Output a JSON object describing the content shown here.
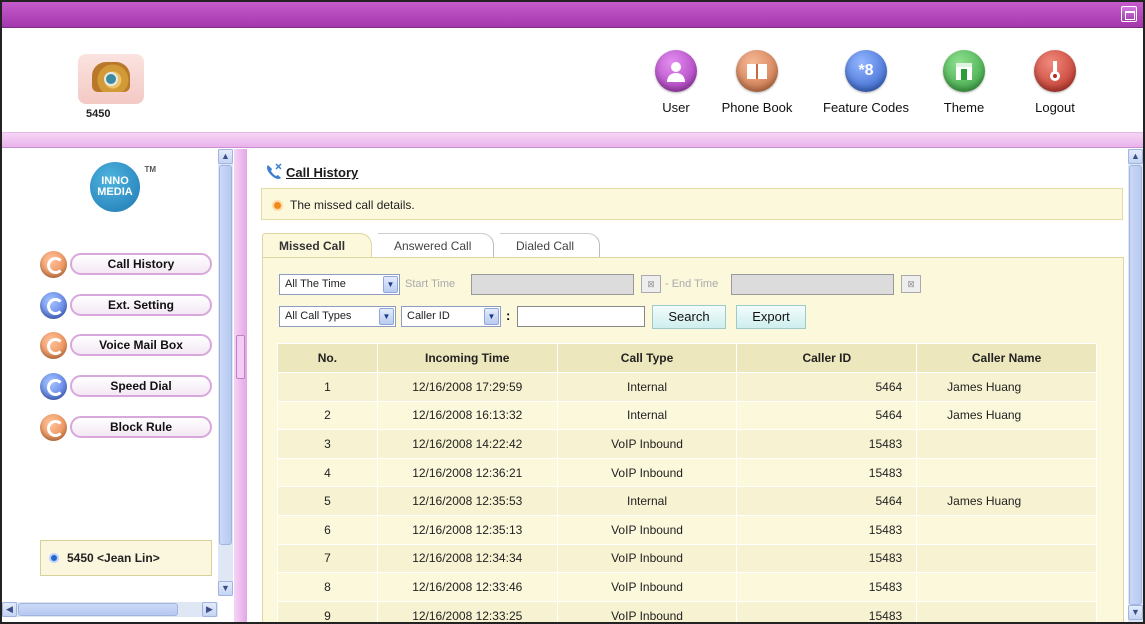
{
  "header": {
    "extension": "5450",
    "nav": [
      {
        "label": "User",
        "icon": "user-icon",
        "color": "#b043c2"
      },
      {
        "label": "Phone Book",
        "icon": "book-icon",
        "color": "#d07a4a"
      },
      {
        "label": "Feature Codes",
        "icon": "star8-icon",
        "glyph": "*8",
        "color": "#3a6fd6"
      },
      {
        "label": "Theme",
        "icon": "theme-icon",
        "color": "#3fb04a"
      },
      {
        "label": "Logout",
        "icon": "key-icon",
        "color": "#c63a2c"
      }
    ]
  },
  "sidebar": {
    "logo": {
      "line1": "INNO",
      "line2": "MEDIA",
      "tm": "TM"
    },
    "items": [
      {
        "label": "Call History",
        "color": "orange"
      },
      {
        "label": "Ext. Setting",
        "color": "blue"
      },
      {
        "label": "Voice Mail Box",
        "color": "orange"
      },
      {
        "label": "Speed Dial",
        "color": "blue"
      },
      {
        "label": "Block Rule",
        "color": "orange"
      }
    ],
    "user": "5450 <Jean Lin>"
  },
  "main": {
    "title": "Call History",
    "info": "The missed call details.",
    "tabs": [
      "Missed Call",
      "Answered Call",
      "Dialed Call"
    ],
    "filters": {
      "time_range": "All The Time",
      "start_label": "Start Time",
      "end_label": "- End Time",
      "call_types": "All Call Types",
      "search_field": "Caller ID",
      "colon": ":",
      "keyword": "",
      "search_button": "Search",
      "export_button": "Export"
    },
    "table": {
      "columns": [
        "No.",
        "Incoming Time",
        "Call Type",
        "Caller ID",
        "Caller Name"
      ],
      "rows": [
        [
          "1",
          "12/16/2008 17:29:59",
          "Internal",
          "5464",
          "James Huang"
        ],
        [
          "2",
          "12/16/2008 16:13:32",
          "Internal",
          "5464",
          "James Huang"
        ],
        [
          "3",
          "12/16/2008 14:22:42",
          "VoIP Inbound",
          "15483",
          ""
        ],
        [
          "4",
          "12/16/2008 12:36:21",
          "VoIP Inbound",
          "15483",
          ""
        ],
        [
          "5",
          "12/16/2008 12:35:53",
          "Internal",
          "5464",
          "James Huang"
        ],
        [
          "6",
          "12/16/2008 12:35:13",
          "VoIP Inbound",
          "15483",
          ""
        ],
        [
          "7",
          "12/16/2008 12:34:34",
          "VoIP Inbound",
          "15483",
          ""
        ],
        [
          "8",
          "12/16/2008 12:33:46",
          "VoIP Inbound",
          "15483",
          ""
        ],
        [
          "9",
          "12/16/2008 12:33:25",
          "VoIP Inbound",
          "15483",
          ""
        ]
      ]
    }
  }
}
